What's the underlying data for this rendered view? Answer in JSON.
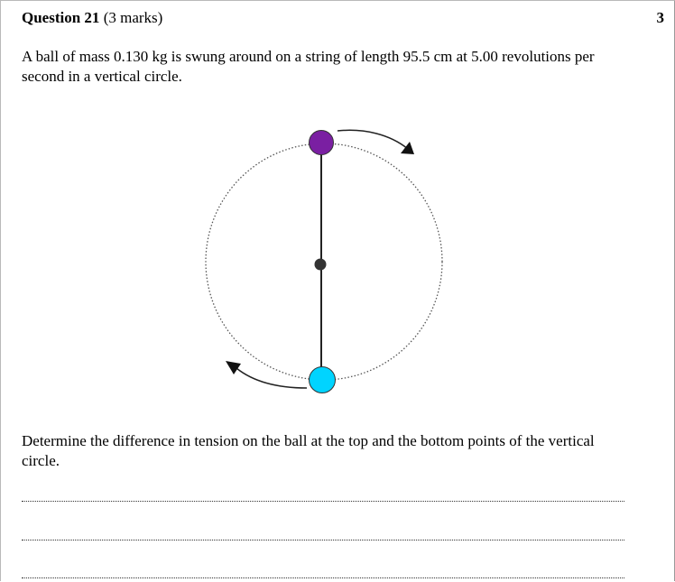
{
  "question": {
    "title": "Question 21",
    "marks": "(3 marks)",
    "marks_total": "3"
  },
  "stem": "A ball of mass 0.130 kg is swung around on a string of length 95.5 cm at 5.00 revolutions per second in a vertical circle.",
  "task": "Determine the difference in tension on the ball at the top and the bottom points of the vertical circle.",
  "answer_lines": 3,
  "colors": {
    "top_ball": "#7a1fa2",
    "bottom_ball": "#00d4ff",
    "center_dot": "#333333",
    "circle_path": "#555555"
  }
}
